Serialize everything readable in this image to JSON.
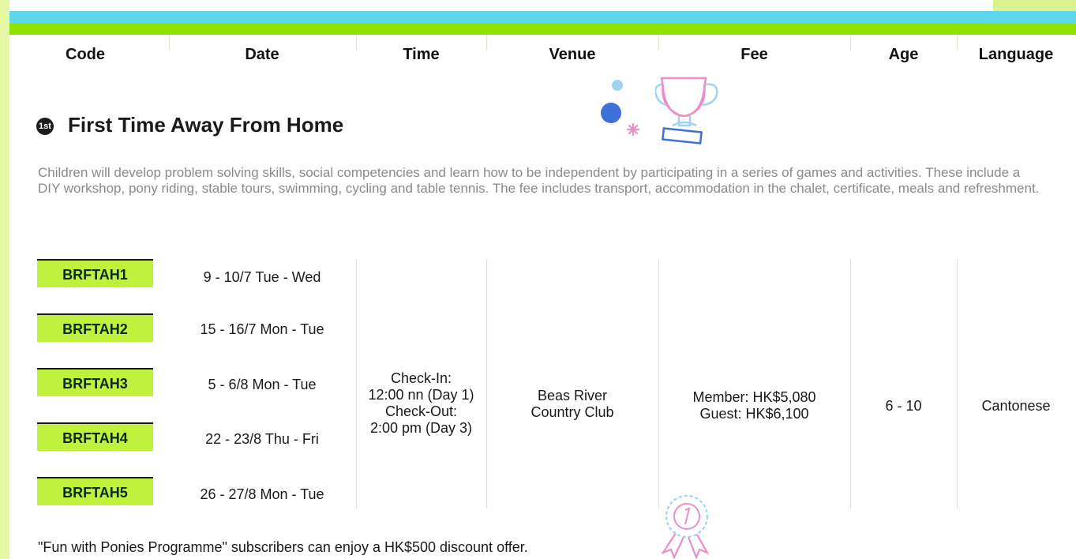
{
  "colors": {
    "page_bg": "#e5f8a3",
    "bar_blue": "#5fd6ea",
    "bar_green": "#8fe100",
    "code_box": "#bff13d",
    "description": "#8a8a8a"
  },
  "table_header": {
    "code": "Code",
    "date": "Date",
    "time": "Time",
    "venue": "Venue",
    "fee": "Fee",
    "age": "Age",
    "language": "Language"
  },
  "section": {
    "badge": "1st",
    "title": "First Time Away From Home",
    "description": "Children will develop problem solving skills, social competencies and learn how to be independent by participating in a series of games and activities. These include a DIY workshop, pony riding, stable tours, swimming, cycling and table tennis. The fee includes transport, accommodation in the chalet, certificate, meals and refreshment."
  },
  "sessions": [
    {
      "code": "BRFTAH1",
      "date": "9 - 10/7 Tue - Wed"
    },
    {
      "code": "BRFTAH2",
      "date": "15 - 16/7 Mon - Tue"
    },
    {
      "code": "BRFTAH3",
      "date": "5 - 6/8 Mon - Tue"
    },
    {
      "code": "BRFTAH4",
      "date": "22 - 23/8 Thu - Fri"
    },
    {
      "code": "BRFTAH5",
      "date": "26 - 27/8 Mon - Tue"
    }
  ],
  "details": {
    "time_lines": [
      "Check-In:",
      "12:00 nn (Day 1)",
      "Check-Out:",
      "2:00 pm (Day 3)"
    ],
    "venue_lines": [
      "Beas River",
      "Country Club"
    ],
    "fee_lines": [
      "Member: HK$5,080",
      "Guest: HK$6,100"
    ],
    "age": "6 - 10",
    "language": "Cantonese"
  },
  "footnote": "\"Fun with Ponies Programme\" subscribers can enjoy a HK$500 discount offer.",
  "icons": {
    "trophy": "trophy-icon",
    "rosette": "rosette-icon",
    "dots": "decorative-dots"
  }
}
